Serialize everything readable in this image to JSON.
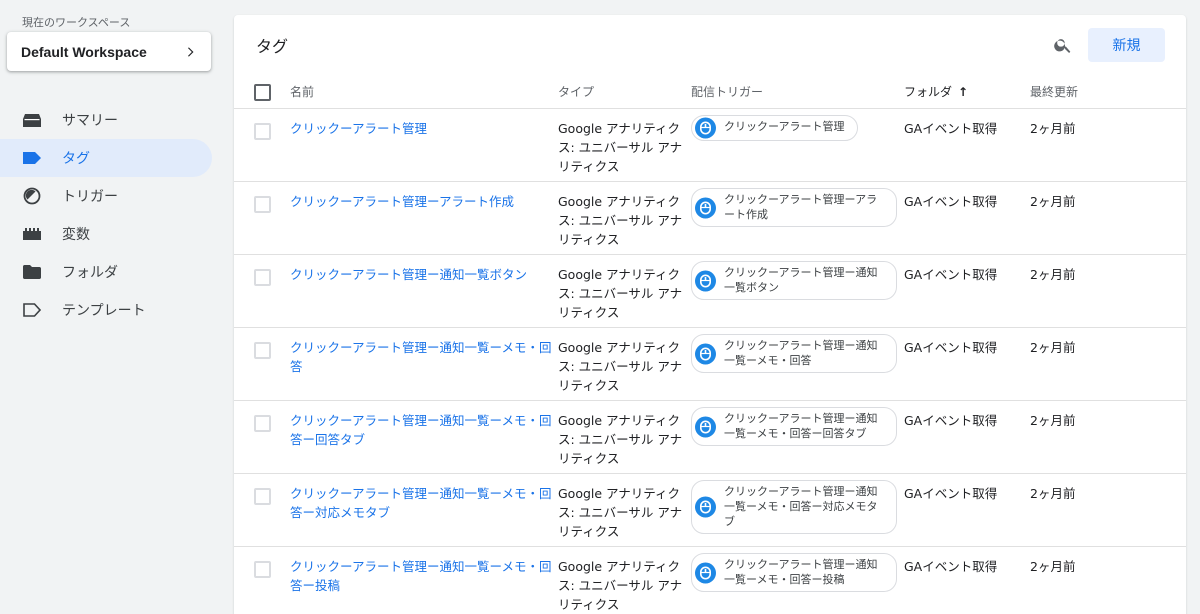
{
  "sidebar": {
    "workspace_label": "現在のワークスペース",
    "workspace_name": "Default Workspace",
    "items": [
      {
        "label": "サマリー",
        "icon": "summary-icon"
      },
      {
        "label": "タグ",
        "icon": "tag-icon",
        "active": true
      },
      {
        "label": "トリガー",
        "icon": "trigger-icon"
      },
      {
        "label": "変数",
        "icon": "variable-icon"
      },
      {
        "label": "フォルダ",
        "icon": "folder-icon"
      },
      {
        "label": "テンプレート",
        "icon": "template-icon"
      }
    ]
  },
  "panel": {
    "title": "タグ",
    "new_button": "新規",
    "columns": {
      "name": "名前",
      "type": "タイプ",
      "trigger": "配信トリガー",
      "folder": "フォルダ",
      "updated": "最終更新"
    },
    "sort_indicator": "↑",
    "rows": [
      {
        "name": "クリックーアラート管理",
        "type": "Google アナリティクス: ユニバーサル アナリティクス",
        "trigger": "クリックーアラート管理",
        "folder": "GAイベント取得",
        "updated": "2ヶ月前"
      },
      {
        "name": "クリックーアラート管理ーアラート作成",
        "type": "Google アナリティクス: ユニバーサル アナリティクス",
        "trigger": "クリックーアラート管理ーアラート作成",
        "folder": "GAイベント取得",
        "updated": "2ヶ月前"
      },
      {
        "name": "クリックーアラート管理ー通知一覧ボタン",
        "type": "Google アナリティクス: ユニバーサル アナリティクス",
        "trigger": "クリックーアラート管理ー通知一覧ボタン",
        "folder": "GAイベント取得",
        "updated": "2ヶ月前"
      },
      {
        "name": "クリックーアラート管理ー通知一覧ーメモ・回答",
        "type": "Google アナリティクス: ユニバーサル アナリティクス",
        "trigger": "クリックーアラート管理ー通知一覧ーメモ・回答",
        "folder": "GAイベント取得",
        "updated": "2ヶ月前"
      },
      {
        "name": "クリックーアラート管理ー通知一覧ーメモ・回答ー回答タブ",
        "type": "Google アナリティクス: ユニバーサル アナリティクス",
        "trigger": "クリックーアラート管理ー通知一覧ーメモ・回答ー回答タブ",
        "folder": "GAイベント取得",
        "updated": "2ヶ月前"
      },
      {
        "name": "クリックーアラート管理ー通知一覧ーメモ・回答ー対応メモタブ",
        "type": "Google アナリティクス: ユニバーサル アナリティクス",
        "trigger": "クリックーアラート管理ー通知一覧ーメモ・回答ー対応メモタブ",
        "folder": "GAイベント取得",
        "updated": "2ヶ月前"
      },
      {
        "name": "クリックーアラート管理ー通知一覧ーメモ・回答ー投稿",
        "type": "Google アナリティクス: ユニバーサル アナリティクス",
        "trigger": "クリックーアラート管理ー通知一覧ーメモ・回答ー投稿",
        "folder": "GAイベント取得",
        "updated": "2ヶ月前"
      }
    ]
  },
  "colors": {
    "accent": "#1a73e8",
    "trigger_icon": "#1e88e5",
    "active_nav_bg": "#e1ebfb"
  }
}
